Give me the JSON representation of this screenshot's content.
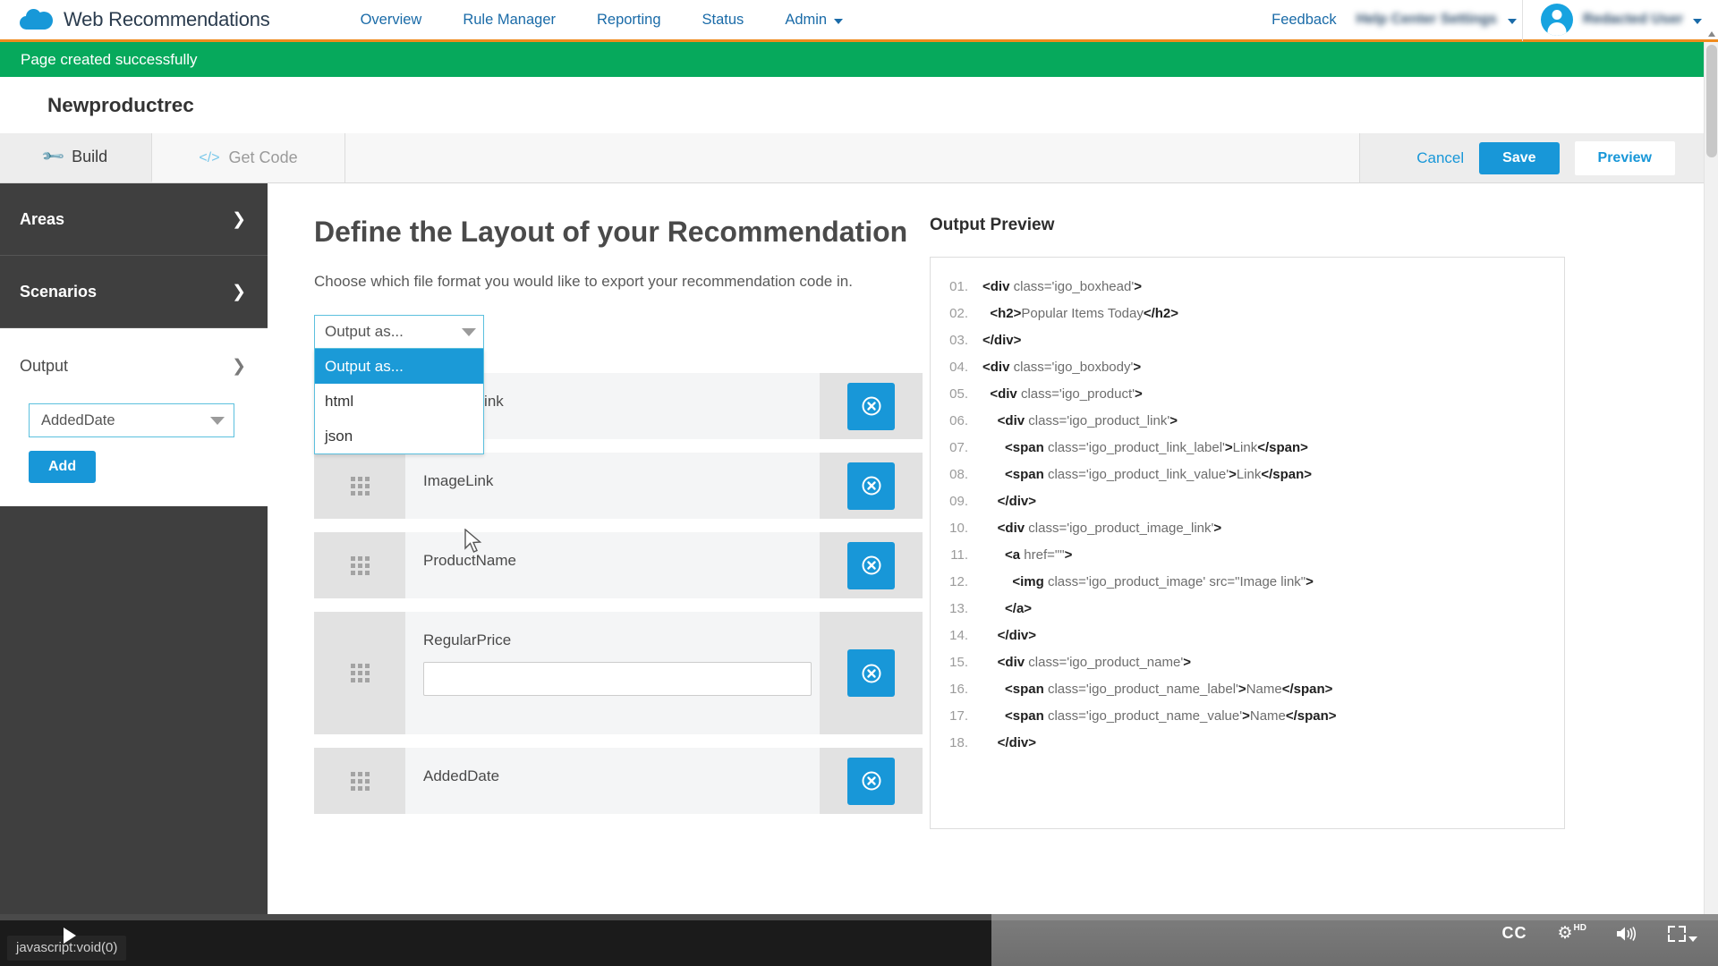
{
  "topnav": {
    "brand": "Web Recommendations",
    "logo_icon": "cloud-logo",
    "items": [
      {
        "label": "Overview",
        "caret": false
      },
      {
        "label": "Rule Manager",
        "caret": false
      },
      {
        "label": "Reporting",
        "caret": false
      },
      {
        "label": "Status",
        "caret": false
      },
      {
        "label": "Admin",
        "caret": true
      }
    ],
    "feedback": "Feedback",
    "redacted_nav": "Help Center Settings",
    "user_name": "Redacted User",
    "user_caret_icon": "chevron-down-icon",
    "avatar_icon": "user-avatar-icon",
    "accent": "#1897d8",
    "underline": "#f08b1d"
  },
  "banner": {
    "message": "Page created successfully",
    "color": "#06a95c"
  },
  "page": {
    "title": "Newproductrec"
  },
  "tabs": [
    {
      "label": "Build",
      "icon": "wrench-icon",
      "active": true
    },
    {
      "label": "Get Code",
      "icon": "code-tag-icon",
      "active": false
    }
  ],
  "toolbar": {
    "cancel_label": "Cancel",
    "save_label": "Save",
    "preview_label": "Preview"
  },
  "sidebar": {
    "items": [
      {
        "label": "Areas",
        "chevron": "❯",
        "state": "collapsed-dark"
      },
      {
        "label": "Scenarios",
        "chevron": "❯",
        "state": "collapsed-dark"
      },
      {
        "label": "Output",
        "chevron": "❯",
        "state": "expanded-light"
      }
    ],
    "field_select": {
      "value": "AddedDate",
      "arrow_icon": "caret-down-icon"
    },
    "add_label": "Add"
  },
  "main": {
    "heading": "Define the Layout of your Recommendation",
    "subheading": "Choose which file format you would like to export your recommendation code in.",
    "output_select": {
      "value": "Output as...",
      "arrow_icon": "caret-down-icon",
      "open": true,
      "options": [
        {
          "label": "Output as...",
          "selected": true
        },
        {
          "label": "html",
          "selected": false
        },
        {
          "label": "json",
          "selected": false
        }
      ]
    },
    "fields": [
      {
        "label": "ProductLink",
        "has_input": false,
        "input_value": "",
        "grip_icon": "drag-grip-icon",
        "remove_icon": "remove-circle-icon"
      },
      {
        "label": "ImageLink",
        "has_input": false,
        "input_value": "",
        "grip_icon": "drag-grip-icon",
        "remove_icon": "remove-circle-icon"
      },
      {
        "label": "ProductName",
        "has_input": false,
        "input_value": "",
        "grip_icon": "drag-grip-icon",
        "remove_icon": "remove-circle-icon"
      },
      {
        "label": "RegularPrice",
        "has_input": true,
        "input_value": "",
        "grip_icon": "drag-grip-icon",
        "remove_icon": "remove-circle-icon"
      },
      {
        "label": "AddedDate",
        "has_input": false,
        "input_value": "",
        "grip_icon": "drag-grip-icon",
        "remove_icon": "remove-circle-icon"
      }
    ]
  },
  "preview": {
    "heading": "Output Preview",
    "lines": [
      {
        "n": "01.",
        "indent": 0,
        "html": "<b>&lt;div</b> class='igo_boxhead'<b>&gt;</b>"
      },
      {
        "n": "02.",
        "indent": 1,
        "html": "<b>&lt;h2&gt;</b>Popular Items Today<b>&lt;/h2&gt;</b>"
      },
      {
        "n": "03.",
        "indent": 0,
        "html": "<b>&lt;/div&gt;</b>"
      },
      {
        "n": "04.",
        "indent": 0,
        "html": "<b>&lt;div</b> class='igo_boxbody'<b>&gt;</b>"
      },
      {
        "n": "05.",
        "indent": 1,
        "html": "<b>&lt;div</b> class='igo_product'<b>&gt;</b>"
      },
      {
        "n": "06.",
        "indent": 2,
        "html": "<b>&lt;div</b> class='igo_product_link'<b>&gt;</b>"
      },
      {
        "n": "07.",
        "indent": 3,
        "html": "<b>&lt;span</b> class='igo_product_link_label'<b>&gt;</b>Link<b>&lt;/span&gt;</b>"
      },
      {
        "n": "08.",
        "indent": 3,
        "html": "<b>&lt;span</b> class='igo_product_link_value'<b>&gt;</b>Link<b>&lt;/span&gt;</b>"
      },
      {
        "n": "09.",
        "indent": 2,
        "html": "<b>&lt;/div&gt;</b>"
      },
      {
        "n": "10.",
        "indent": 2,
        "html": "<b>&lt;div</b> class='igo_product_image_link'<b>&gt;</b>"
      },
      {
        "n": "11.",
        "indent": 3,
        "html": "<b>&lt;a</b> href=\"\"<b>&gt;</b>"
      },
      {
        "n": "12.",
        "indent": 4,
        "html": "<b>&lt;img</b> class='igo_product_image' src=\"Image link\"<b>&gt;</b>"
      },
      {
        "n": "13.",
        "indent": 3,
        "html": "<b>&lt;/a&gt;</b>"
      },
      {
        "n": "14.",
        "indent": 2,
        "html": "<b>&lt;/div&gt;</b>"
      },
      {
        "n": "15.",
        "indent": 2,
        "html": "<b>&lt;div</b> class='igo_product_name'<b>&gt;</b>"
      },
      {
        "n": "16.",
        "indent": 3,
        "html": "<b>&lt;span</b> class='igo_product_name_label'<b>&gt;</b>Name<b>&lt;/span&gt;</b>"
      },
      {
        "n": "17.",
        "indent": 3,
        "html": "<b>&lt;span</b> class='igo_product_name_value'<b>&gt;</b>Name<b>&lt;/span&gt;</b>"
      },
      {
        "n": "18.",
        "indent": 2,
        "html": "<b>&lt;/div&gt;</b>"
      }
    ]
  },
  "player": {
    "status_url": "javascript:void(0)",
    "cc_label": "CC",
    "hd_label": "HD",
    "gear_icon": "gear-icon",
    "volume_icon": "volume-icon",
    "fullscreen_icon": "exit-fullscreen-icon",
    "play_icon": "play-icon"
  }
}
